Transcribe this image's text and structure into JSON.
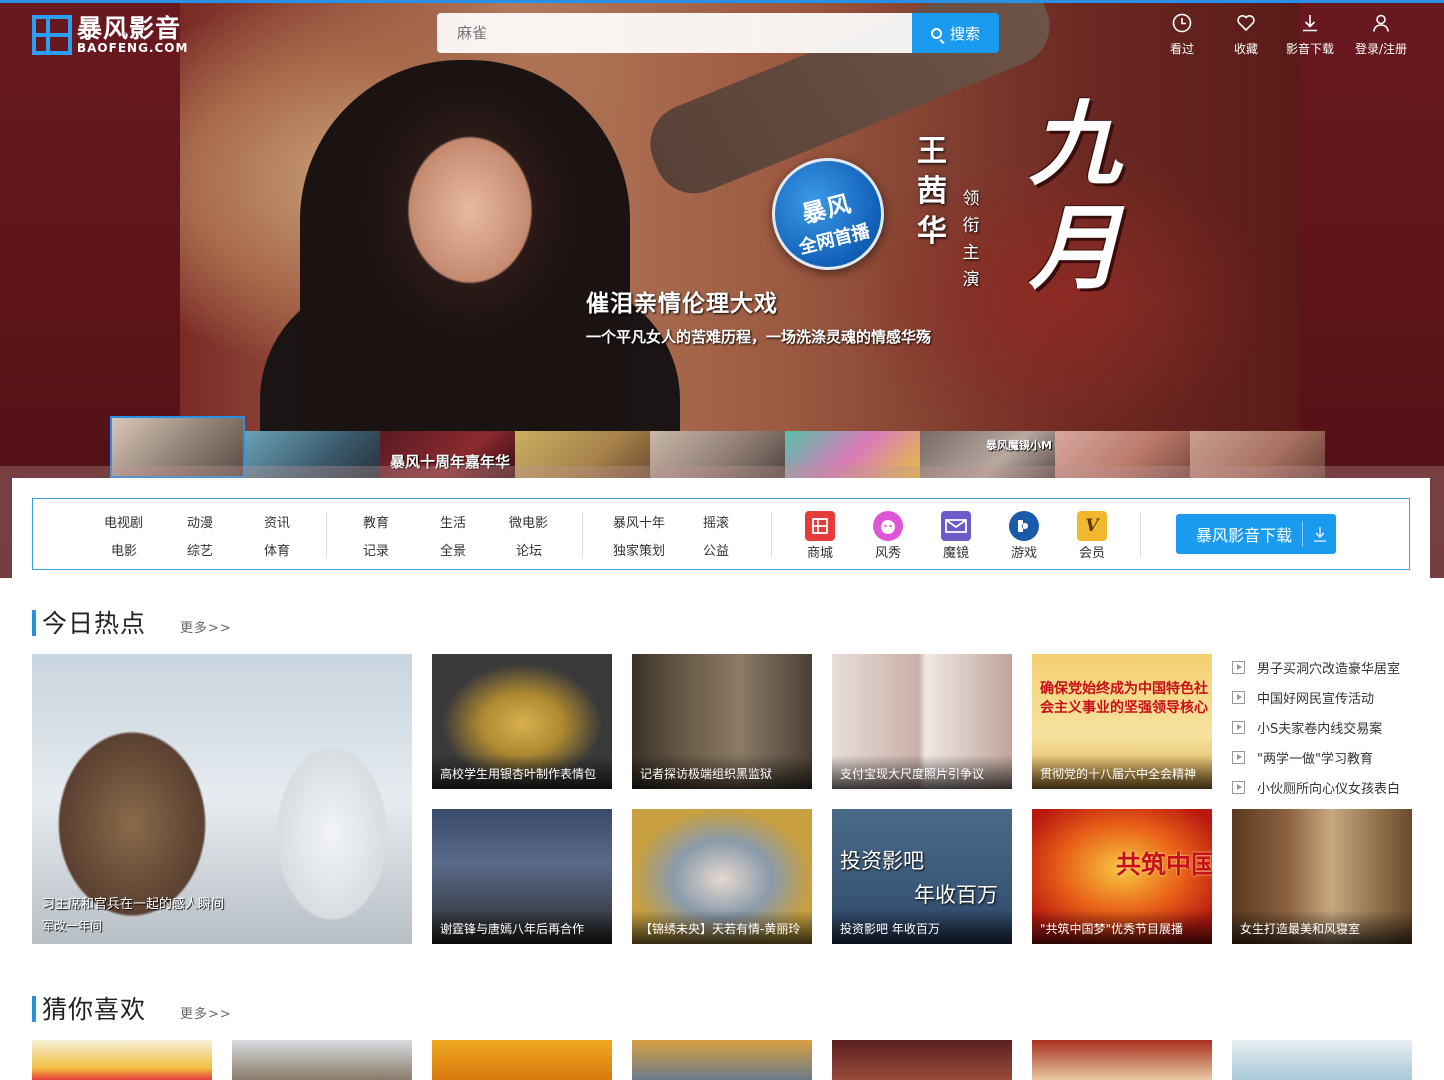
{
  "header": {
    "logo_cn": "暴风影音",
    "logo_en": "BAOFENG.COM",
    "search_placeholder": "麻雀",
    "search_button": "搜索",
    "nav": [
      {
        "label": "看过",
        "icon": "history-clock-icon"
      },
      {
        "label": "收藏",
        "icon": "heart-icon"
      },
      {
        "label": "影音下载",
        "icon": "download-icon"
      },
      {
        "label": "登录/注册",
        "icon": "user-icon"
      }
    ]
  },
  "hero": {
    "badge_line1": "暴风",
    "badge_line2": "全网首播",
    "tagline": "催泪亲情伦理大戏",
    "subtitle": "一个平凡女人的苦难历程，一场洗涤灵魂的情感华殇",
    "actor": "王茜华",
    "lead_role": "领衔主演",
    "title": "九月",
    "thumbs": [
      {
        "label": ""
      },
      {
        "label": ""
      },
      {
        "label": "暴风十周年嘉年华"
      },
      {
        "label": ""
      },
      {
        "label": ""
      },
      {
        "label": ""
      },
      {
        "label": "暴风魔镜小M"
      },
      {
        "label": ""
      },
      {
        "label": ""
      }
    ]
  },
  "categories": {
    "group1": [
      "电视剧",
      "动漫",
      "资讯",
      "电影",
      "综艺",
      "体育"
    ],
    "group2": [
      "教育",
      "生活",
      "微电影",
      "记录",
      "全景",
      "论坛"
    ],
    "group3": [
      "暴风十年",
      "摇滚",
      "独家策划",
      "公益"
    ],
    "services": [
      {
        "label": "商城",
        "icon": "mall-icon",
        "color": "#e53b3b"
      },
      {
        "label": "风秀",
        "icon": "fengxiu-icon",
        "color": "#e055d6"
      },
      {
        "label": "魔镜",
        "icon": "vr-mirror-icon",
        "color": "#6b5bc7"
      },
      {
        "label": "游戏",
        "icon": "game-icon",
        "color": "#1a5aa8"
      },
      {
        "label": "会员",
        "icon": "vip-icon",
        "color": "#f2b82d"
      }
    ],
    "download_button": "暴风影音下载"
  },
  "hot_today": {
    "title": "今日热点",
    "more": "更多>>",
    "feature": {
      "line1": "习主席和官兵在一起的感人瞬间",
      "line2": "军改一年间"
    },
    "cards": [
      {
        "caption": "高校学生用银杏叶制作表情包"
      },
      {
        "caption": "记者探访极端组织黑监狱"
      },
      {
        "caption": "支付宝现大尺度照片引争议"
      },
      {
        "caption": "贯彻党的十八届六中全会精神",
        "overlay": "确保党始终成为中国特色社会主义事业的坚强领导核心"
      },
      {
        "caption": "谢霆锋与唐嫣八年后再合作"
      },
      {
        "caption": "【锦绣未央】天若有情-黄丽玲"
      },
      {
        "caption": "投资影吧 年收百万",
        "overlay1": "投资影吧",
        "overlay2": "年收百万"
      },
      {
        "caption": "\"共筑中国梦\"优秀节目展播",
        "overlay": "共筑中国梦"
      },
      {
        "caption": "女生打造最美和风寝室"
      }
    ],
    "side_list": [
      "男子买洞穴改造豪华居室",
      "中国好网民宣传活动",
      "小S夫家卷内线交易案",
      "\"两学一做\"学习教育",
      "小伙厕所向心仪女孩表白"
    ]
  },
  "guess": {
    "title": "猜你喜欢",
    "more": "更多>>"
  },
  "colors": {
    "accent": "#1b9bf0",
    "hero_bg": "#5a1418"
  }
}
